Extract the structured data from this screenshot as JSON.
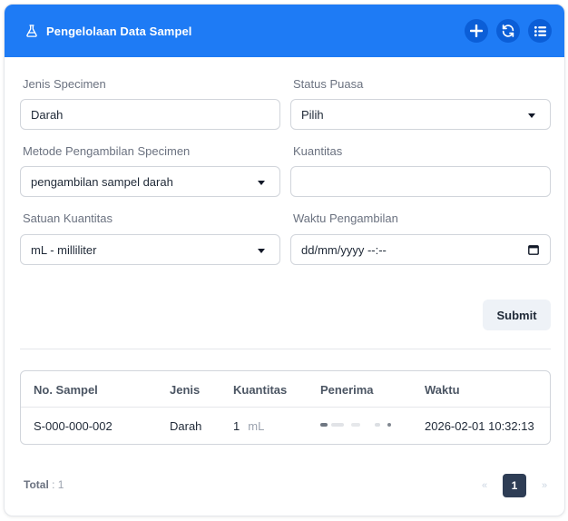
{
  "header": {
    "title": "Pengelolaan Data Sampel",
    "icon": "flask-icon",
    "buttons": [
      {
        "name": "add",
        "icon": "plus-icon"
      },
      {
        "name": "refresh",
        "icon": "refresh-icon"
      },
      {
        "name": "list",
        "icon": "list-icon"
      }
    ]
  },
  "form": {
    "jenis_specimen": {
      "label": "Jenis Specimen",
      "value": "Darah"
    },
    "status_puasa": {
      "label": "Status Puasa",
      "value": "Pilih"
    },
    "metode": {
      "label": "Metode Pengambilan Specimen",
      "value": "pengambilan sampel darah"
    },
    "kuantitas": {
      "label": "Kuantitas",
      "value": ""
    },
    "satuan": {
      "label": "Satuan Kuantitas",
      "value": "mL - milliliter"
    },
    "waktu": {
      "label": "Waktu Pengambilan",
      "value": "dd/mm/yyyy --:--"
    },
    "submit_label": "Submit"
  },
  "table": {
    "headers": [
      "No. Sampel",
      "Jenis",
      "Kuantitas",
      "Penerima",
      "Waktu"
    ],
    "rows": [
      {
        "no": "S-000-000-002",
        "jenis": "Darah",
        "qty": "1",
        "unit": "mL",
        "penerima": "",
        "waktu": "2026-02-01 10:32:13"
      }
    ]
  },
  "footer": {
    "total_label": "Total",
    "total_value": ": 1",
    "prev": "«",
    "page": "1",
    "next": "»"
  },
  "colors": {
    "header_bg": "#1e7bf5",
    "header_btn": "#0b5ed7",
    "page_active": "#2e3d55"
  }
}
